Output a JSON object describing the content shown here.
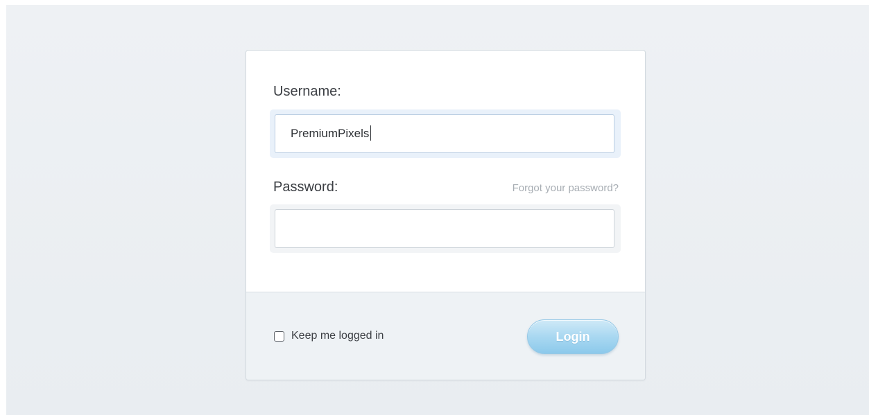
{
  "form": {
    "username_label": "Username:",
    "username_value": "PremiumPixels",
    "password_label": "Password:",
    "password_value": "",
    "forgot_link": "Forgot your password?",
    "remember_label": "Keep me logged in",
    "remember_checked": false,
    "login_label": "Login"
  },
  "colors": {
    "background": "#eef1f4",
    "card": "#ffffff",
    "footer": "#eef2f5",
    "button": "#a9d8f1",
    "button_text": "#ffffff",
    "link": "#a7adb3"
  }
}
